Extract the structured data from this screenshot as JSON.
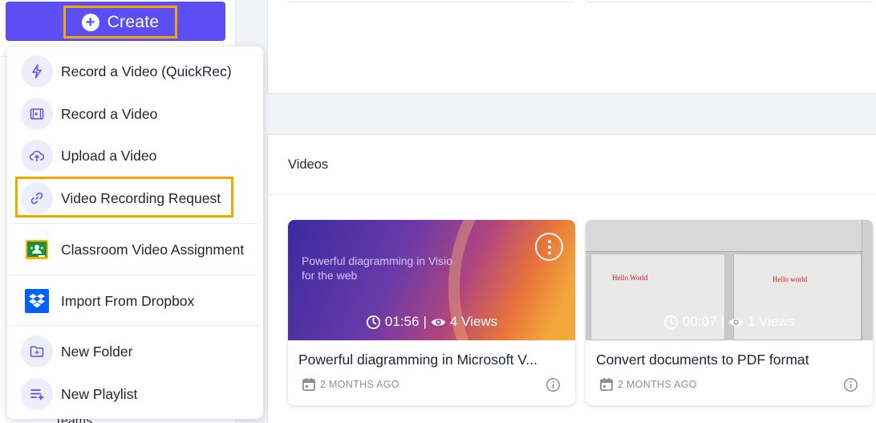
{
  "sidebar": {
    "create_label": "Create",
    "teams_label": "Teams"
  },
  "menu": {
    "items": [
      {
        "label": "Record a Video (QuickRec)",
        "icon": "lightning-icon"
      },
      {
        "label": "Record a Video",
        "icon": "video-record-icon"
      },
      {
        "label": "Upload a Video",
        "icon": "cloud-upload-icon"
      },
      {
        "label": "Video Recording Request",
        "icon": "link-icon"
      },
      {
        "label": "Classroom Video Assignment",
        "icon": "google-classroom-icon"
      },
      {
        "label": "Import From Dropbox",
        "icon": "dropbox-icon"
      },
      {
        "label": "New Folder",
        "icon": "new-folder-icon"
      },
      {
        "label": "New Playlist",
        "icon": "playlist-add-icon"
      }
    ]
  },
  "videos": {
    "section_title": "Videos",
    "cards": [
      {
        "title": "Powerful diagramming in Microsoft V...",
        "thumb_text": "Powerful diagramming in Visio for the web",
        "duration": "01:56",
        "views": "4 Views",
        "date": "2 MONTHS AGO"
      },
      {
        "title": "Convert documents to PDF format",
        "thumb_text_left": "Hello World",
        "thumb_text_right": "Hello world",
        "duration": "00:07",
        "views": "1 Views",
        "date": "2 MONTHS AGO"
      }
    ]
  },
  "colors": {
    "accent": "#5b4ef5",
    "highlight": "#f7a600",
    "icon_bg": "#eeedfb"
  }
}
